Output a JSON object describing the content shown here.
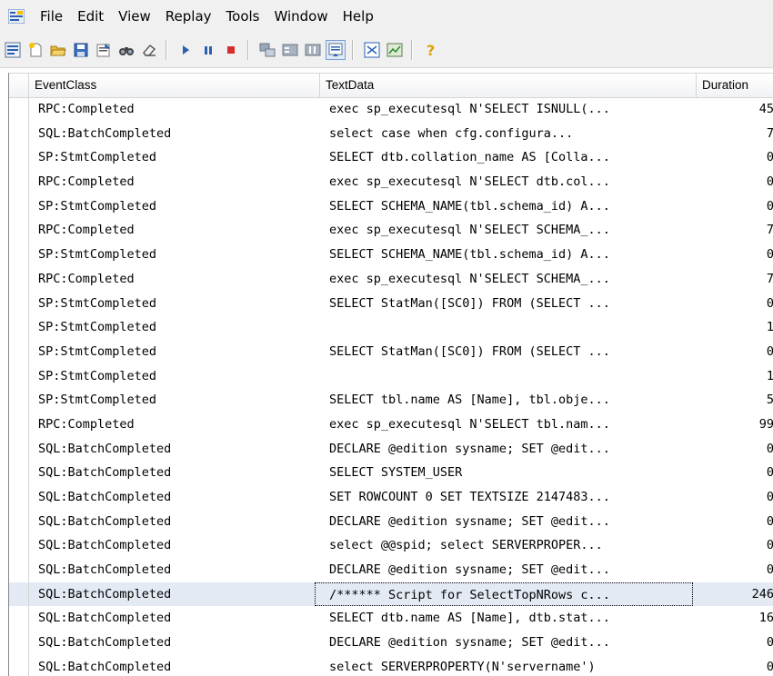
{
  "menu": {
    "items": [
      "File",
      "Edit",
      "View",
      "Replay",
      "Tools",
      "Window",
      "Help"
    ]
  },
  "toolbar": {
    "buttons": [
      "new-trace",
      "new-template",
      "open",
      "save",
      "properties",
      "find",
      "clear",
      "run",
      "pause",
      "stop",
      "connect",
      "columns",
      "filter",
      "autoscroll",
      "trace-view",
      "chart",
      "help"
    ]
  },
  "grid": {
    "columns": [
      "EventClass",
      "TextData",
      "Duration"
    ],
    "rows": [
      {
        "event": "RPC:Completed",
        "text": "exec sp_executesql N'SELECT ISNULL(...",
        "duration": "45"
      },
      {
        "event": "SQL:BatchCompleted",
        "text": "select   case   when cfg.configura...",
        "duration": "7"
      },
      {
        "event": "SP:StmtCompleted",
        "text": "SELECT dtb.collation_name AS [Colla...",
        "duration": "0"
      },
      {
        "event": "RPC:Completed",
        "text": "exec sp_executesql N'SELECT dtb.col...",
        "duration": "0"
      },
      {
        "event": "SP:StmtCompleted",
        "text": "SELECT SCHEMA_NAME(tbl.schema_id) A...",
        "duration": "0"
      },
      {
        "event": "RPC:Completed",
        "text": "exec sp_executesql N'SELECT SCHEMA_...",
        "duration": "7"
      },
      {
        "event": "SP:StmtCompleted",
        "text": "SELECT SCHEMA_NAME(tbl.schema_id) A...",
        "duration": "0"
      },
      {
        "event": "RPC:Completed",
        "text": "exec sp_executesql N'SELECT SCHEMA_...",
        "duration": "7"
      },
      {
        "event": "SP:StmtCompleted",
        "text": "SELECT StatMan([SC0]) FROM (SELECT ...",
        "duration": "0"
      },
      {
        "event": "SP:StmtCompleted",
        "text": "",
        "duration": "1"
      },
      {
        "event": "SP:StmtCompleted",
        "text": "SELECT StatMan([SC0]) FROM (SELECT ...",
        "duration": "0"
      },
      {
        "event": "SP:StmtCompleted",
        "text": "",
        "duration": "1"
      },
      {
        "event": "SP:StmtCompleted",
        "text": "SELECT tbl.name AS [Name], tbl.obje...",
        "duration": "5"
      },
      {
        "event": "RPC:Completed",
        "text": "exec sp_executesql N'SELECT tbl.nam...",
        "duration": "99"
      },
      {
        "event": "SQL:BatchCompleted",
        "text": "DECLARE @edition sysname; SET @edit...",
        "duration": "0"
      },
      {
        "event": "SQL:BatchCompleted",
        "text": "SELECT SYSTEM_USER",
        "duration": "0"
      },
      {
        "event": "SQL:BatchCompleted",
        "text": "SET ROWCOUNT 0 SET TEXTSIZE 2147483...",
        "duration": "0"
      },
      {
        "event": "SQL:BatchCompleted",
        "text": "DECLARE @edition sysname; SET @edit...",
        "duration": "0"
      },
      {
        "event": "SQL:BatchCompleted",
        "text": "select @@spid;  select SERVERPROPER...",
        "duration": "0"
      },
      {
        "event": "SQL:BatchCompleted",
        "text": "DECLARE @edition sysname; SET @edit...",
        "duration": "0"
      },
      {
        "event": "SQL:BatchCompleted",
        "text": "/****** Script for SelectTopNRows c...",
        "duration": "246",
        "selected": true
      },
      {
        "event": "SQL:BatchCompleted",
        "text": "SELECT dtb.name AS [Name], dtb.stat...",
        "duration": "16"
      },
      {
        "event": "SQL:BatchCompleted",
        "text": "DECLARE @edition sysname; SET @edit...",
        "duration": "0"
      },
      {
        "event": "SQL:BatchCompleted",
        "text": "select SERVERPROPERTY(N'servername')",
        "duration": "0"
      }
    ]
  },
  "colors": {
    "selected_row": "#e4eaf4",
    "chrome": "#f0f0f0",
    "grid_line": "#d5d5d5",
    "stop_red": "#d92b2b",
    "run_blue": "#2a5fb4"
  }
}
